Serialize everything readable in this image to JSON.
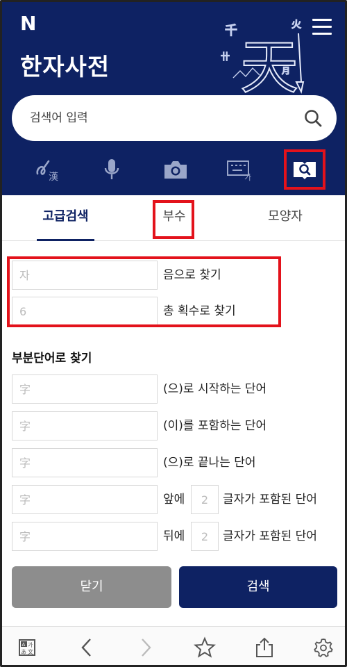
{
  "header": {
    "logo": "N",
    "title": "한자사전",
    "art_chars": [
      "千",
      "火",
      "天",
      "月",
      "卄"
    ]
  },
  "search": {
    "placeholder": "검색어 입력"
  },
  "tools": [
    "handwriting-icon",
    "microphone-icon",
    "camera-icon",
    "keyboard-icon",
    "advanced-search-icon"
  ],
  "tabs": [
    {
      "label": "고급검색"
    },
    {
      "label": "부수"
    },
    {
      "label": "모양자"
    }
  ],
  "form": {
    "sound": {
      "placeholder": "자",
      "label": "음으로 찾기"
    },
    "strokes": {
      "placeholder": "6",
      "label": "총 획수로 찾기"
    },
    "partial_title": "부분단어로 찾기",
    "rows": [
      {
        "placeholder": "字",
        "label": "(으)로 시작하는 단어"
      },
      {
        "placeholder": "字",
        "label": "(이)를 포함하는 단어"
      },
      {
        "placeholder": "字",
        "label": "(으)로 끝나는 단어"
      }
    ],
    "front": {
      "placeholder": "字",
      "prefix": "앞에",
      "count": "2",
      "suffix": "글자가 포함된 단어"
    },
    "back": {
      "placeholder": "字",
      "prefix": "뒤에",
      "count": "2",
      "suffix": "글자가 포함된 단어"
    }
  },
  "buttons": {
    "close": "닫기",
    "search": "검색"
  },
  "bottombar": [
    "translate-icon",
    "back-icon",
    "forward-icon",
    "star-icon",
    "share-icon",
    "settings-icon"
  ],
  "colors": {
    "brand": "#0e2263",
    "highlight": "#e3121b",
    "close_button": "#8d8d8d"
  }
}
